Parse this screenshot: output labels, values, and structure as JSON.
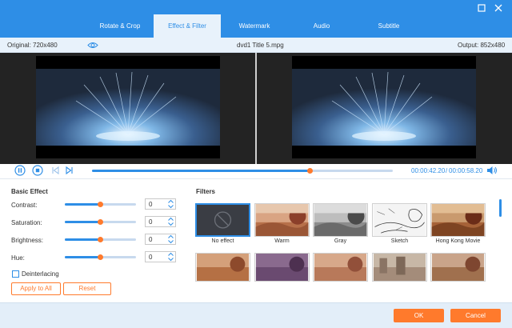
{
  "tabs": [
    {
      "label": "Rotate & Crop"
    },
    {
      "label": "Effect & Filter"
    },
    {
      "label": "Watermark"
    },
    {
      "label": "Audio"
    },
    {
      "label": "Subtitle"
    }
  ],
  "info": {
    "original": "Original: 720x480",
    "file": "dvd1 Title 5.mpg",
    "output": "Output: 852x480"
  },
  "playback": {
    "current": "00:00:42.20",
    "separator": "/",
    "total": "00:00:58.20",
    "progress_fraction": 0.724
  },
  "basic_effect": {
    "title": "Basic Effect",
    "controls": [
      {
        "label": "Contrast:",
        "value": "0",
        "level": 0.5
      },
      {
        "label": "Saturation:",
        "value": "0",
        "level": 0.5
      },
      {
        "label": "Brightness:",
        "value": "0",
        "level": 0.5
      },
      {
        "label": "Hue:",
        "value": "0",
        "level": 0.5
      }
    ],
    "deinterlacing": {
      "label": "Deinterlacing",
      "checked": false
    },
    "apply_all": "Apply to All",
    "reset": "Reset"
  },
  "filters": {
    "title": "Filters",
    "items": [
      {
        "name": "No effect",
        "selected": true
      },
      {
        "name": "Warm"
      },
      {
        "name": "Gray"
      },
      {
        "name": "Sketch"
      },
      {
        "name": "Hong Kong Movie"
      }
    ]
  },
  "footer": {
    "ok": "OK",
    "cancel": "Cancel"
  },
  "colors": {
    "accent": "#2e8ee6",
    "orange": "#ff7a2c"
  },
  "icons": {
    "minimize": "minimize-icon",
    "close": "close-icon",
    "eye": "eye-icon",
    "pause": "pause-icon",
    "stop": "stop-icon",
    "prev": "previous-icon",
    "next": "next-icon",
    "volume": "volume-icon",
    "no_effect": "no-entry-icon"
  }
}
